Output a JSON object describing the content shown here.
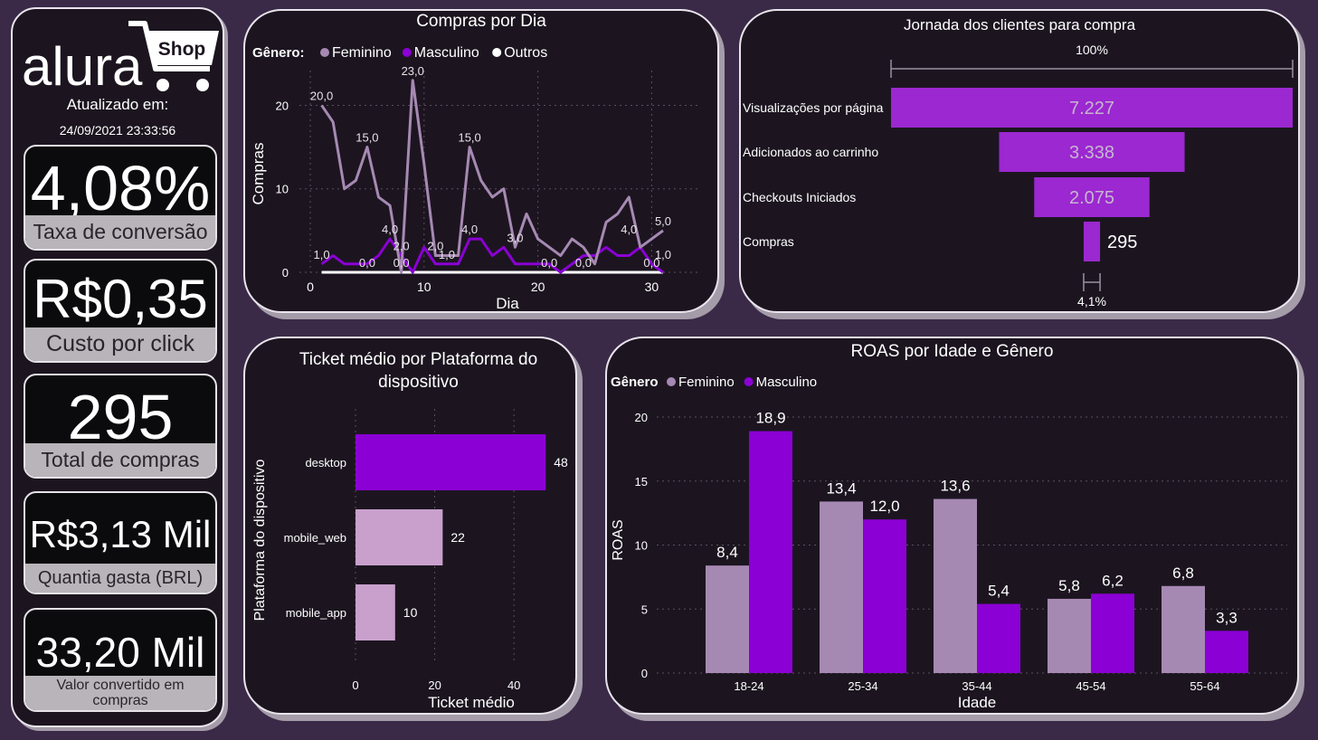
{
  "brand": {
    "logo_text": "alura",
    "logo_badge": "Shop"
  },
  "updated": {
    "label": "Atualizado em:",
    "datetime": "24/09/2021 23:33:56"
  },
  "kpis": [
    {
      "value": "4,08%",
      "label": "Taxa de conversão"
    },
    {
      "value": "R$0,35",
      "label": "Custo por click"
    },
    {
      "value": "295",
      "label": "Total de compras"
    },
    {
      "value": "R$3,13 Mil",
      "label": "Quantia gasta (BRL)"
    },
    {
      "value": "33,20 Mil",
      "label": "Valor convertido em compras"
    }
  ],
  "colors": {
    "feminino": "#a689b3",
    "masculino": "#8b00d4",
    "outros": "#ffffff",
    "funnel": "#9b28d0",
    "mobile": "#c9a0cc",
    "panel_bg": "#1c1520",
    "page_bg": "#3a2a48"
  },
  "chart_data": [
    {
      "id": "compras-por-dia",
      "type": "line",
      "title": "Compras por Dia",
      "legend_title": "Gênero:",
      "xlabel": "Dia",
      "ylabel": "Compras",
      "xticks": [
        0,
        10,
        20,
        30
      ],
      "yticks": [
        0,
        10,
        20
      ],
      "xlim": [
        0,
        31
      ],
      "ylim": [
        0,
        22
      ],
      "x": [
        1,
        2,
        3,
        4,
        5,
        6,
        7,
        8,
        9,
        10,
        11,
        12,
        13,
        14,
        15,
        16,
        17,
        18,
        19,
        20,
        21,
        22,
        23,
        24,
        25,
        26,
        27,
        28,
        29,
        30,
        31
      ],
      "series": [
        {
          "name": "Feminino",
          "values": [
            20,
            18,
            10,
            11,
            15,
            9,
            8,
            0,
            23,
            13,
            2,
            2,
            2,
            15,
            11,
            9,
            10,
            3,
            7,
            4,
            3,
            2,
            4,
            3,
            1,
            6,
            7,
            9,
            3,
            4,
            5
          ]
        },
        {
          "name": "Masculino",
          "values": [
            1,
            2,
            1,
            1,
            1,
            2,
            4,
            2,
            0,
            3,
            1,
            1,
            1,
            4,
            4,
            2,
            3,
            1,
            1,
            1,
            1,
            0,
            1,
            2,
            2,
            3,
            2,
            2,
            3,
            1,
            0
          ]
        },
        {
          "name": "Outros",
          "values": [
            0,
            0,
            0,
            0,
            0,
            0,
            0,
            0,
            0,
            0,
            0,
            0,
            0,
            0,
            0,
            0,
            0,
            0,
            0,
            0,
            0,
            0,
            0,
            0,
            0,
            0,
            0,
            0,
            0,
            0,
            0
          ]
        }
      ],
      "data_labels": [
        {
          "x": 1,
          "y": 20,
          "text": "20,0"
        },
        {
          "x": 5,
          "y": 15,
          "text": "15,0"
        },
        {
          "x": 9,
          "y": 23,
          "text": "23,0"
        },
        {
          "x": 14,
          "y": 15,
          "text": "15,0"
        },
        {
          "x": 1,
          "y": 1,
          "text": "1,0"
        },
        {
          "x": 5,
          "y": 0,
          "text": "0,0"
        },
        {
          "x": 7,
          "y": 4,
          "text": "4,0"
        },
        {
          "x": 8,
          "y": 2,
          "text": "2,0"
        },
        {
          "x": 8,
          "y": 0,
          "text": "0,0"
        },
        {
          "x": 11,
          "y": 2,
          "text": "2,0"
        },
        {
          "x": 12,
          "y": 1,
          "text": "1,0"
        },
        {
          "x": 14,
          "y": 4,
          "text": "4,0"
        },
        {
          "x": 18,
          "y": 3,
          "text": "3,0"
        },
        {
          "x": 21,
          "y": 0,
          "text": "0,0"
        },
        {
          "x": 24,
          "y": 0,
          "text": "0,0"
        },
        {
          "x": 28,
          "y": 4,
          "text": "4,0"
        },
        {
          "x": 31,
          "y": 5,
          "text": "5,0"
        },
        {
          "x": 31,
          "y": 1,
          "text": "1,0"
        },
        {
          "x": 30,
          "y": 0,
          "text": "0,0"
        }
      ]
    },
    {
      "id": "jornada",
      "type": "funnel",
      "title": "Jornada dos clientes para compra",
      "top_percent": "100%",
      "bottom_percent": "4,1%",
      "categories": [
        "Visualizações por página",
        "Adicionados ao carrinho",
        "Checkouts Iniciados",
        "Compras"
      ],
      "values": [
        7227,
        3338,
        2075,
        295
      ],
      "labels": [
        "7.227",
        "3.338",
        "2.075",
        "295"
      ]
    },
    {
      "id": "ticket-medio",
      "type": "bar",
      "orientation": "horizontal",
      "title": "Ticket médio por Plataforma do dispositivo",
      "xlabel": "Ticket médio",
      "ylabel": "Plataforma do dispositivo",
      "xticks": [
        0,
        20,
        40
      ],
      "xlim": [
        0,
        50
      ],
      "categories": [
        "desktop",
        "mobile_web",
        "mobile_app"
      ],
      "values": [
        48,
        22,
        10
      ],
      "labels": [
        "48",
        "22",
        "10"
      ]
    },
    {
      "id": "roas",
      "type": "bar",
      "title": "ROAS por Idade e Gênero",
      "legend_title": "Gênero",
      "xlabel": "Idade",
      "ylabel": "ROAS",
      "yticks": [
        0,
        5,
        10,
        15,
        20
      ],
      "ylim": [
        0,
        20
      ],
      "categories": [
        "18-24",
        "25-34",
        "35-44",
        "45-54",
        "55-64"
      ],
      "series": [
        {
          "name": "Feminino",
          "values": [
            8.4,
            13.4,
            13.6,
            5.8,
            6.8
          ],
          "labels": [
            "8,4",
            "13,4",
            "13,6",
            "5,8",
            "6,8"
          ]
        },
        {
          "name": "Masculino",
          "values": [
            18.9,
            12.0,
            5.4,
            6.2,
            3.3
          ],
          "labels": [
            "18,9",
            "12,0",
            "5,4",
            "6,2",
            "3,3"
          ]
        }
      ]
    }
  ]
}
